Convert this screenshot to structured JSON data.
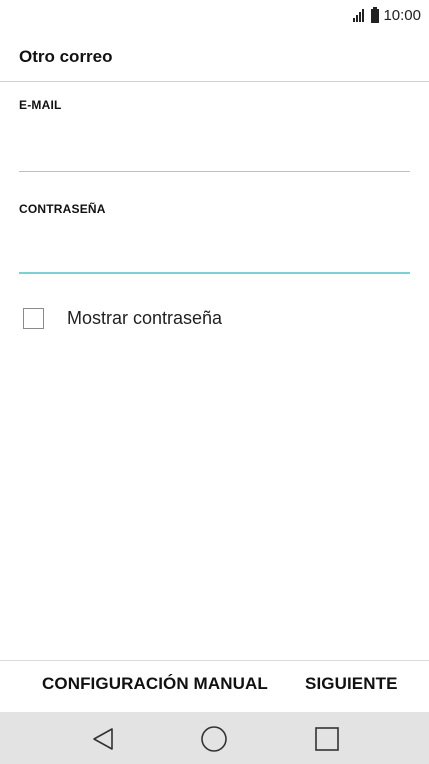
{
  "status_bar": {
    "time": "10:00",
    "signal_icon": "signal-icon",
    "battery_icon": "battery-icon"
  },
  "header": {
    "title": "Otro correo"
  },
  "form": {
    "email": {
      "label": "E-MAIL",
      "value": ""
    },
    "password": {
      "label": "CONTRASEÑA",
      "value": ""
    },
    "show_password": {
      "label": "Mostrar contraseña",
      "checked": false
    }
  },
  "actions": {
    "manual_label": "CONFIGURACIÓN MANUAL",
    "next_label": "SIGUIENTE"
  },
  "nav": {
    "back_icon": "back-triangle-icon",
    "home_icon": "home-circle-icon",
    "recent_icon": "recent-square-icon"
  },
  "colors": {
    "focus_underline": "#7fd0d6",
    "nav_background": "#e3e3e3"
  }
}
